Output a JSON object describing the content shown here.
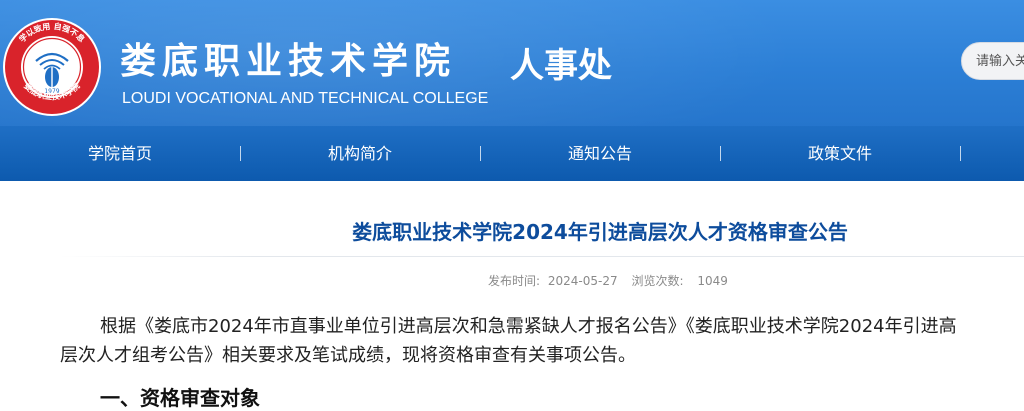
{
  "header": {
    "college_name": "娄底职业技术学院",
    "department": "人事处",
    "college_name_en": "LOUDI VOCATIONAL AND TECHNICAL COLLEGE",
    "search_placeholder": "请输入关"
  },
  "emblem": {
    "ring_text_top": "学以致用 自强不息",
    "ring_text_bottom": "娄底职业技术学院",
    "year": "1979"
  },
  "nav": {
    "items": [
      {
        "label": "学院首页"
      },
      {
        "label": "机构简介"
      },
      {
        "label": "通知公告"
      },
      {
        "label": "政策文件"
      }
    ]
  },
  "article": {
    "title": "娄底职业技术学院2024年引进高层次人才资格审查公告",
    "publish_label": "发布时间:",
    "publish_date": "2024-05-27",
    "views_label": "浏览次数:",
    "views": "1049",
    "paragraph_line1": "根据《娄底市2024年市直事业单位引进高层次和急需紧缺人才报名公告》《娄底职业技术学院2024年引进高",
    "paragraph_line2": "层次人才组考公告》相关要求及笔试成绩，现将资格审查有关事项公告。",
    "section_heading": "一、资格审查对象"
  },
  "colors": {
    "header_blue": "#2c7fd6",
    "nav_blue": "#0d5aae",
    "title_blue": "#0d4c9c",
    "emblem_red": "#d9232b"
  }
}
